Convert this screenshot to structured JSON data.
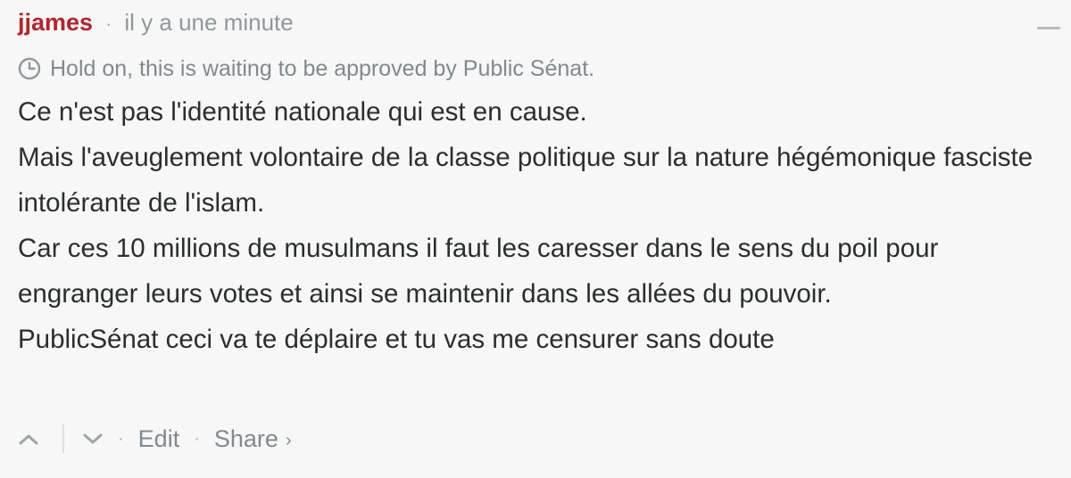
{
  "comment": {
    "author": "jjames",
    "separator": "·",
    "time": "il y a une minute",
    "pending_notice": "Hold on, this is waiting to be approved by Public Sénat.",
    "body_lines": [
      "Ce n'est pas l'identité nationale qui est en cause.",
      "Mais l'aveuglement volontaire de la classe politique sur la nature hégémonique fasciste intolérante de l'islam.",
      "Car ces 10 millions de musulmans il faut les caresser dans le sens du poil pour engranger leurs votes et ainsi se maintenir dans les allées du pouvoir.",
      "PublicSénat ceci va te déplaire et tu vas me censurer sans doute"
    ]
  },
  "footer": {
    "dot1": "·",
    "edit_label": "Edit",
    "dot2": "·",
    "share_label": "Share",
    "share_chevron": "›"
  },
  "colors": {
    "author": "#b5242a",
    "muted": "#7f8a90",
    "text": "#2a2e2e",
    "background": "#f7f7f7"
  },
  "icons": {
    "pending": "clock-icon",
    "upvote": "chevron-up-icon",
    "downvote": "chevron-down-icon",
    "collapse": "minus-icon"
  }
}
